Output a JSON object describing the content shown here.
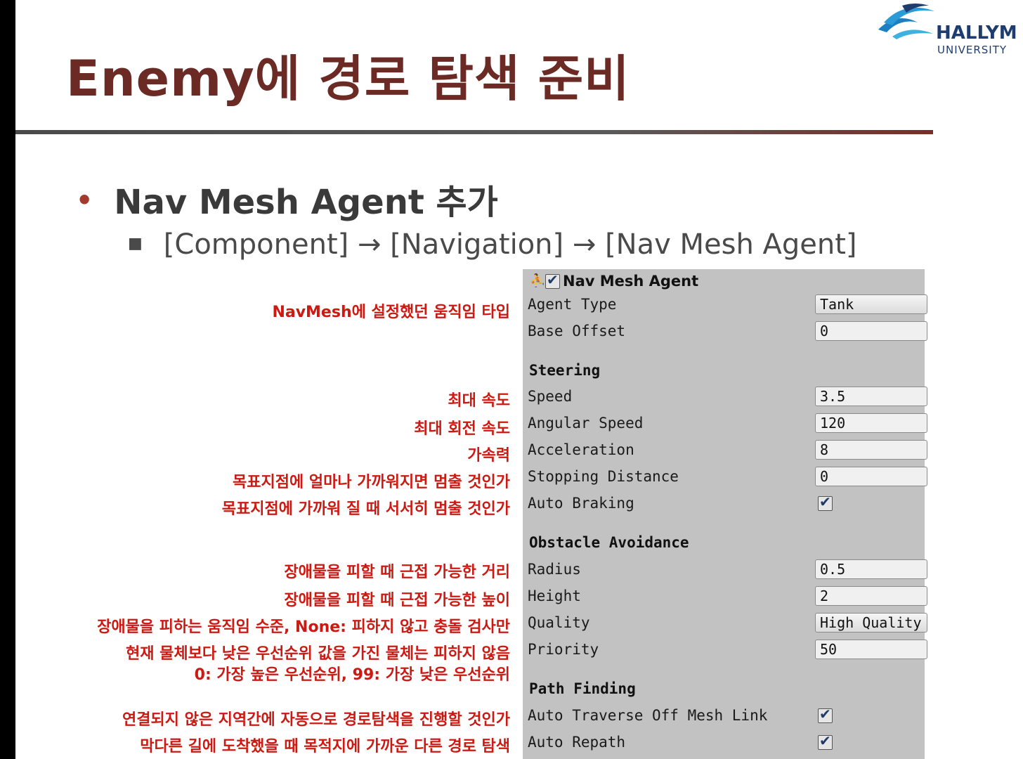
{
  "slide": {
    "title": "Enemy에 경로 탐색 준비",
    "bullet1": "Nav Mesh Agent 추가",
    "bullet2": "[Component] → [Navigation] → [Nav Mesh Agent]"
  },
  "logo": {
    "name": "HALLYM",
    "sub": "UNIVERSITY"
  },
  "panel": {
    "header": "Nav Mesh Agent",
    "fields": [
      {
        "label": "Agent Type",
        "value": "Tank",
        "kind": "dropdown"
      },
      {
        "label": "Base Offset",
        "value": "0",
        "kind": "text"
      }
    ],
    "sections": [
      {
        "title": "Steering",
        "fields": [
          {
            "label": "Speed",
            "value": "3.5",
            "kind": "text"
          },
          {
            "label": "Angular Speed",
            "value": "120",
            "kind": "text"
          },
          {
            "label": "Acceleration",
            "value": "8",
            "kind": "text"
          },
          {
            "label": "Stopping Distance",
            "value": "0",
            "kind": "text"
          },
          {
            "label": "Auto Braking",
            "value": true,
            "kind": "checkbox"
          }
        ]
      },
      {
        "title": "Obstacle Avoidance",
        "fields": [
          {
            "label": "Radius",
            "value": "0.5",
            "kind": "text"
          },
          {
            "label": "Height",
            "value": "2",
            "kind": "text"
          },
          {
            "label": "Quality",
            "value": "High Quality",
            "kind": "dropdown"
          },
          {
            "label": "Priority",
            "value": "50",
            "kind": "text"
          }
        ]
      },
      {
        "title": "Path Finding",
        "fields": [
          {
            "label": "Auto Traverse Off Mesh Link",
            "value": true,
            "kind": "checkbox"
          },
          {
            "label": "Auto Repath",
            "value": true,
            "kind": "checkbox"
          }
        ]
      }
    ]
  },
  "annotations": [
    "NavMesh에 설정했던 움직임 타입",
    "최대 속도",
    "최대 회전 속도",
    "가속력",
    "목표지점에 얼마나 가까워지면 멈출 것인가",
    "목표지점에 가까워 질 때 서서히 멈출 것인가",
    "장애물을 피할 때 근접 가능한 거리",
    "장애물을 피할 때 근접 가능한 높이",
    "장애물을 피하는 움직임 수준, None: 피하지 않고 충돌 검사만",
    "현재 물체보다 낮은 우선순위 값을 가진 물체는 피하지 않음",
    "0: 가장 높은 우선순위, 99: 가장 낮은 우선순위",
    "연결되지 않은 지역간에 자동으로 경로탐색을 진행할 것인가",
    "막다른 길에 도착했을 때 목적지에 가까운 다른 경로 탐색"
  ],
  "colors": {
    "title": "#6b2b24",
    "annotation": "#cc1a12",
    "panel": "#c2c2c2",
    "logo": "#1e3d6e"
  }
}
